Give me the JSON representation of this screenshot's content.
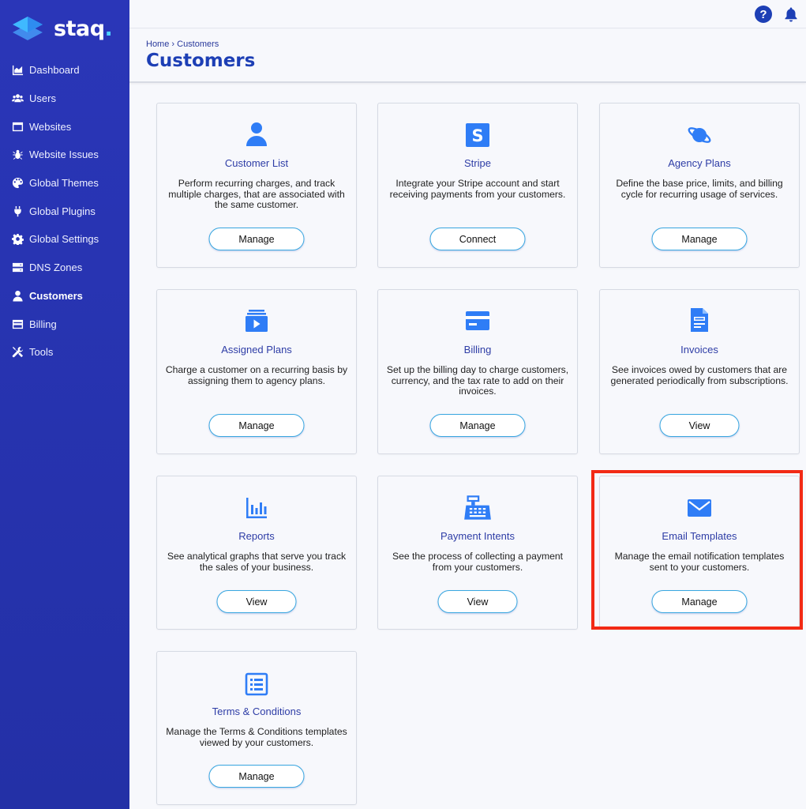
{
  "app": {
    "name": "staq",
    "dot": "."
  },
  "sidebar": {
    "items": [
      {
        "label": "Dashboard",
        "icon": "chart-area-icon"
      },
      {
        "label": "Users",
        "icon": "users-icon"
      },
      {
        "label": "Websites",
        "icon": "window-icon"
      },
      {
        "label": "Website Issues",
        "icon": "bug-icon"
      },
      {
        "label": "Global Themes",
        "icon": "palette-icon"
      },
      {
        "label": "Global Plugins",
        "icon": "plug-icon"
      },
      {
        "label": "Global Settings",
        "icon": "gear-icon"
      },
      {
        "label": "DNS Zones",
        "icon": "server-icon"
      },
      {
        "label": "Customers",
        "icon": "user-icon",
        "active": true
      },
      {
        "label": "Billing",
        "icon": "billing-icon"
      },
      {
        "label": "Tools",
        "icon": "tools-icon"
      }
    ]
  },
  "topbar": {
    "help_label": "?"
  },
  "header": {
    "breadcrumb_home": "Home",
    "breadcrumb_sep": " › ",
    "breadcrumb_current": "Customers",
    "title": "Customers"
  },
  "cards": [
    {
      "title": "Customer List",
      "description": "Perform recurring charges, and track multiple charges, that are associated with the same customer.",
      "button": "Manage",
      "icon": "user-icon"
    },
    {
      "title": "Stripe",
      "description": "Integrate your Stripe account and start receiving payments from your customers.",
      "button": "Connect",
      "icon": "stripe-icon"
    },
    {
      "title": "Agency Plans",
      "description": "Define the base price, limits, and billing cycle for recurring usage of services.",
      "button": "Manage",
      "icon": "planet-icon"
    },
    {
      "title": "Assigned Plans",
      "description": "Charge a customer on a recurring basis by assigning them to agency plans.",
      "button": "Manage",
      "icon": "playlist-icon"
    },
    {
      "title": "Billing",
      "description": "Set up the billing day to charge customers, currency, and the tax rate to add on their invoices.",
      "button": "Manage",
      "icon": "credit-card-icon"
    },
    {
      "title": "Invoices",
      "description": "See invoices owed by customers that are generated periodically from subscriptions.",
      "button": "View",
      "icon": "invoice-icon"
    },
    {
      "title": "Reports",
      "description": "See analytical graphs that serve you track the sales of your business.",
      "button": "View",
      "icon": "bar-chart-icon"
    },
    {
      "title": "Payment Intents",
      "description": "See the process of collecting a payment from your customers.",
      "button": "View",
      "icon": "cash-register-icon"
    },
    {
      "title": "Email Templates",
      "description": "Manage the email notification templates sent to your customers.",
      "button": "Manage",
      "icon": "envelope-icon"
    },
    {
      "title": "Terms & Conditions",
      "description": "Manage the Terms & Conditions templates viewed by your customers.",
      "button": "Manage",
      "icon": "list-icon"
    }
  ],
  "colors": {
    "sidebar": "#2a36b8",
    "accent": "#1d3fb5",
    "icon_blue": "#2f7df6",
    "button_border": "#39a7e0",
    "highlight": "#f22a15"
  }
}
